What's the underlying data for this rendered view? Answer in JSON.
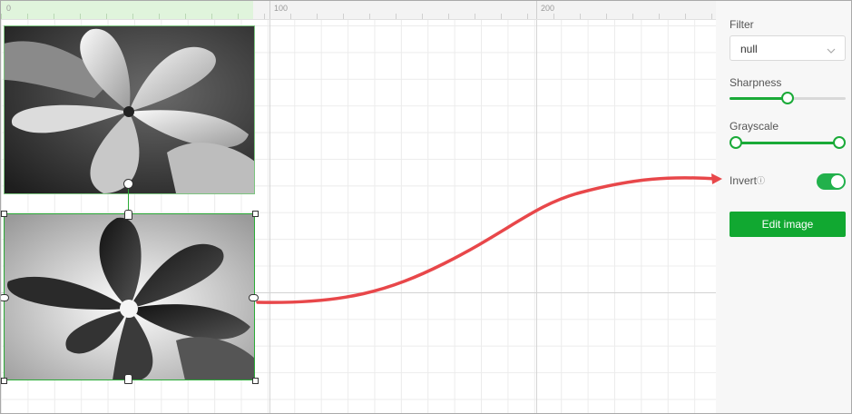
{
  "ruler": {
    "labels": [
      "0",
      "100",
      "200"
    ]
  },
  "panel": {
    "filter": {
      "label": "Filter",
      "value": "null"
    },
    "sharpness": {
      "label": "Sharpness",
      "value": 0.5
    },
    "grayscale": {
      "label": "Grayscale",
      "range": [
        0,
        1
      ]
    },
    "invert": {
      "label": "Invert",
      "info_icon": "info-icon",
      "enabled": true
    },
    "edit_button": "Edit image"
  },
  "colors": {
    "accent": "#1aaa38",
    "annotation_arrow": "#e8474a"
  }
}
